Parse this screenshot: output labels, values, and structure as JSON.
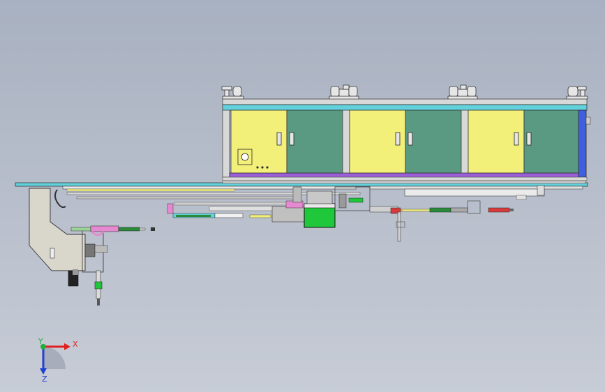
{
  "viewport": {
    "background_top": "#a8b1c1",
    "background_bottom": "#c7ccd6"
  },
  "model": {
    "cabinet_count": 3,
    "colors": {
      "door_yellow": "#f3f07a",
      "door_green": "#5b9a82",
      "frame_cyan": "#62d1dc",
      "base_purple": "#9a5fd6",
      "end_blue": "#3d5fe0",
      "frame_gray": "#d8d8d8",
      "hopper_gray": "#d9d6cc",
      "green_box": "#1ec83a",
      "cylinder_red": "#d63a3a",
      "pink_part": "#e58ad0"
    }
  },
  "triad": {
    "x_label": "X",
    "y_label": "Y",
    "z_label": "Z",
    "x_color": "#e02020",
    "y_color": "#20b040",
    "z_color": "#2040d0"
  }
}
